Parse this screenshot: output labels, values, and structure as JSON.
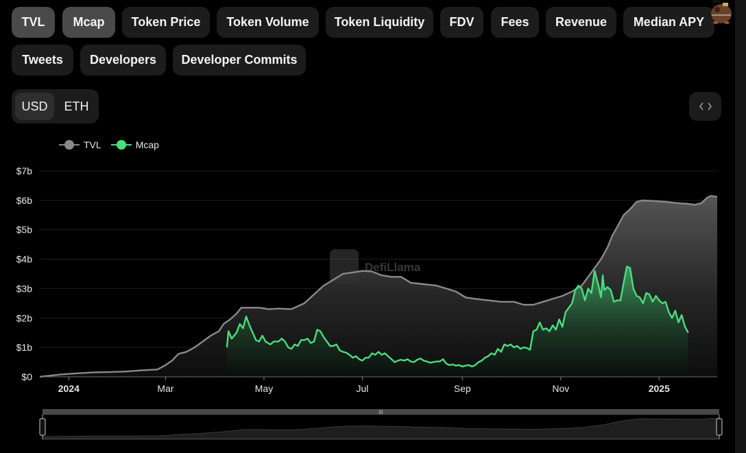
{
  "tabs": [
    {
      "label": "TVL",
      "active": true
    },
    {
      "label": "Mcap",
      "active": true
    },
    {
      "label": "Token Price",
      "active": false
    },
    {
      "label": "Token Volume",
      "active": false
    },
    {
      "label": "Token Liquidity",
      "active": false
    },
    {
      "label": "FDV",
      "active": false
    },
    {
      "label": "Fees",
      "active": false
    },
    {
      "label": "Revenue",
      "active": false
    },
    {
      "label": "Median APY",
      "active": false
    },
    {
      "label": "Tweets",
      "active": false
    },
    {
      "label": "Developers",
      "active": false
    },
    {
      "label": "Developer Commits",
      "active": false
    }
  ],
  "denomination": {
    "options": [
      "USD",
      "ETH"
    ],
    "selected": "USD"
  },
  "embed_button": {
    "icon": "code-brackets-icon",
    "glyph": "< >"
  },
  "mascot": {
    "icon": "llama-mascot-icon"
  },
  "watermark": {
    "text": "DefiLlama",
    "icon": "defillama-logo-icon"
  },
  "colors": {
    "tvl": "#8a8a8a",
    "mcap": "#4ade80",
    "tab_active_bg": "#4a4a4a",
    "tab_bg": "#1c1c1c",
    "background": "#000000"
  },
  "chart_data": {
    "type": "area",
    "title": "",
    "xlabel": "",
    "ylabel": "",
    "x_unit": "days since 2024-01-01",
    "xlim": [
      -18,
      402
    ],
    "ylim": [
      0,
      7
    ],
    "y_unit": "USD billions",
    "y_ticks": [
      {
        "value": 0,
        "label": "$0"
      },
      {
        "value": 1,
        "label": "$1b"
      },
      {
        "value": 2,
        "label": "$2b"
      },
      {
        "value": 3,
        "label": "$3b"
      },
      {
        "value": 4,
        "label": "$4b"
      },
      {
        "value": 5,
        "label": "$5b"
      },
      {
        "value": 6,
        "label": "$6b"
      },
      {
        "value": 7,
        "label": "$7b"
      }
    ],
    "x_ticks": [
      {
        "value": 0,
        "label": "2024",
        "bold": true
      },
      {
        "value": 60,
        "label": "Mar",
        "bold": false
      },
      {
        "value": 121,
        "label": "May",
        "bold": false
      },
      {
        "value": 182,
        "label": "Jul",
        "bold": false
      },
      {
        "value": 244,
        "label": "Sep",
        "bold": false
      },
      {
        "value": 305,
        "label": "Nov",
        "bold": false
      },
      {
        "value": 366,
        "label": "2025",
        "bold": true
      }
    ],
    "grid": true,
    "legend_position": "top-left",
    "series": [
      {
        "name": "TVL",
        "color": "#8a8a8a",
        "points": [
          [
            -18,
            0.0
          ],
          [
            -5,
            0.08
          ],
          [
            5,
            0.12
          ],
          [
            15,
            0.15
          ],
          [
            25,
            0.16
          ],
          [
            35,
            0.18
          ],
          [
            45,
            0.22
          ],
          [
            55,
            0.25
          ],
          [
            60,
            0.4
          ],
          [
            64,
            0.55
          ],
          [
            68,
            0.78
          ],
          [
            73,
            0.85
          ],
          [
            78,
            1.0
          ],
          [
            83,
            1.2
          ],
          [
            88,
            1.4
          ],
          [
            93,
            1.55
          ],
          [
            96,
            1.8
          ],
          [
            100,
            1.95
          ],
          [
            104,
            2.15
          ],
          [
            107,
            2.35
          ],
          [
            112,
            2.35
          ],
          [
            118,
            2.35
          ],
          [
            124,
            2.3
          ],
          [
            130,
            2.32
          ],
          [
            138,
            2.3
          ],
          [
            146,
            2.5
          ],
          [
            152,
            2.8
          ],
          [
            158,
            3.1
          ],
          [
            164,
            3.3
          ],
          [
            170,
            3.5
          ],
          [
            176,
            3.55
          ],
          [
            182,
            3.6
          ],
          [
            188,
            3.58
          ],
          [
            194,
            3.45
          ],
          [
            200,
            3.4
          ],
          [
            206,
            3.4
          ],
          [
            212,
            3.2
          ],
          [
            220,
            3.15
          ],
          [
            228,
            3.1
          ],
          [
            234,
            3.0
          ],
          [
            240,
            2.9
          ],
          [
            246,
            2.7
          ],
          [
            252,
            2.65
          ],
          [
            260,
            2.6
          ],
          [
            268,
            2.55
          ],
          [
            276,
            2.55
          ],
          [
            282,
            2.45
          ],
          [
            288,
            2.45
          ],
          [
            294,
            2.55
          ],
          [
            300,
            2.65
          ],
          [
            306,
            2.75
          ],
          [
            312,
            2.9
          ],
          [
            318,
            3.1
          ],
          [
            322,
            3.4
          ],
          [
            326,
            3.7
          ],
          [
            330,
            4.0
          ],
          [
            334,
            4.4
          ],
          [
            337,
            4.8
          ],
          [
            340,
            5.1
          ],
          [
            344,
            5.5
          ],
          [
            348,
            5.7
          ],
          [
            352,
            5.95
          ],
          [
            356,
            6.0
          ],
          [
            362,
            5.98
          ],
          [
            370,
            5.95
          ],
          [
            378,
            5.9
          ],
          [
            384,
            5.88
          ],
          [
            388,
            5.85
          ],
          [
            392,
            5.9
          ],
          [
            396,
            6.1
          ],
          [
            398,
            6.15
          ],
          [
            402,
            6.12
          ]
        ]
      },
      {
        "name": "Mcap",
        "color": "#4ade80",
        "points": [
          [
            98,
            1.0
          ],
          [
            99,
            1.55
          ],
          [
            101,
            1.3
          ],
          [
            104,
            1.5
          ],
          [
            106,
            1.8
          ],
          [
            108,
            1.65
          ],
          [
            110,
            2.05
          ],
          [
            112,
            1.75
          ],
          [
            114,
            1.5
          ],
          [
            116,
            1.25
          ],
          [
            118,
            1.2
          ],
          [
            120,
            1.4
          ],
          [
            122,
            1.2
          ],
          [
            125,
            1.1
          ],
          [
            127,
            1.2
          ],
          [
            130,
            1.2
          ],
          [
            132,
            1.3
          ],
          [
            134,
            1.2
          ],
          [
            136,
            1.0
          ],
          [
            138,
            0.95
          ],
          [
            140,
            1.1
          ],
          [
            142,
            1.05
          ],
          [
            144,
            1.25
          ],
          [
            146,
            1.25
          ],
          [
            148,
            1.3
          ],
          [
            150,
            1.15
          ],
          [
            152,
            1.2
          ],
          [
            154,
            1.6
          ],
          [
            156,
            1.55
          ],
          [
            158,
            1.35
          ],
          [
            160,
            1.2
          ],
          [
            162,
            1.05
          ],
          [
            164,
            1.05
          ],
          [
            166,
            1.1
          ],
          [
            168,
            0.9
          ],
          [
            170,
            0.85
          ],
          [
            172,
            0.82
          ],
          [
            174,
            0.75
          ],
          [
            176,
            0.65
          ],
          [
            178,
            0.7
          ],
          [
            180,
            0.6
          ],
          [
            182,
            0.55
          ],
          [
            184,
            0.65
          ],
          [
            186,
            0.65
          ],
          [
            188,
            0.8
          ],
          [
            190,
            0.75
          ],
          [
            192,
            0.85
          ],
          [
            194,
            0.75
          ],
          [
            196,
            0.8
          ],
          [
            198,
            0.7
          ],
          [
            200,
            0.6
          ],
          [
            202,
            0.5
          ],
          [
            204,
            0.55
          ],
          [
            206,
            0.58
          ],
          [
            208,
            0.55
          ],
          [
            210,
            0.6
          ],
          [
            212,
            0.52
          ],
          [
            214,
            0.5
          ],
          [
            216,
            0.58
          ],
          [
            218,
            0.62
          ],
          [
            220,
            0.55
          ],
          [
            222,
            0.52
          ],
          [
            224,
            0.48
          ],
          [
            226,
            0.5
          ],
          [
            228,
            0.52
          ],
          [
            230,
            0.52
          ],
          [
            232,
            0.6
          ],
          [
            234,
            0.45
          ],
          [
            236,
            0.4
          ],
          [
            238,
            0.42
          ],
          [
            240,
            0.38
          ],
          [
            242,
            0.4
          ],
          [
            244,
            0.35
          ],
          [
            246,
            0.38
          ],
          [
            248,
            0.4
          ],
          [
            250,
            0.35
          ],
          [
            252,
            0.4
          ],
          [
            254,
            0.5
          ],
          [
            256,
            0.55
          ],
          [
            258,
            0.65
          ],
          [
            260,
            0.7
          ],
          [
            262,
            0.8
          ],
          [
            264,
            0.75
          ],
          [
            266,
            0.95
          ],
          [
            268,
            0.85
          ],
          [
            270,
            1.1
          ],
          [
            272,
            1.05
          ],
          [
            274,
            1.1
          ],
          [
            276,
            1.0
          ],
          [
            278,
            1.05
          ],
          [
            280,
            0.95
          ],
          [
            282,
            1.0
          ],
          [
            284,
            0.98
          ],
          [
            286,
            0.92
          ],
          [
            288,
            1.55
          ],
          [
            290,
            1.6
          ],
          [
            292,
            1.85
          ],
          [
            294,
            1.6
          ],
          [
            296,
            1.65
          ],
          [
            298,
            1.55
          ],
          [
            300,
            1.75
          ],
          [
            302,
            1.6
          ],
          [
            304,
            1.95
          ],
          [
            306,
            1.7
          ],
          [
            308,
            2.2
          ],
          [
            310,
            2.35
          ],
          [
            312,
            2.5
          ],
          [
            314,
            2.95
          ],
          [
            316,
            3.1
          ],
          [
            318,
            3.0
          ],
          [
            320,
            2.6
          ],
          [
            322,
            3.0
          ],
          [
            324,
            2.85
          ],
          [
            326,
            3.6
          ],
          [
            328,
            3.2
          ],
          [
            330,
            2.7
          ],
          [
            331,
            3.45
          ],
          [
            332,
            2.95
          ],
          [
            334,
            3.05
          ],
          [
            336,
            2.95
          ],
          [
            338,
            2.55
          ],
          [
            340,
            2.6
          ],
          [
            342,
            2.6
          ],
          [
            344,
            3.2
          ],
          [
            346,
            3.75
          ],
          [
            348,
            3.7
          ],
          [
            350,
            3.0
          ],
          [
            352,
            2.75
          ],
          [
            354,
            2.7
          ],
          [
            356,
            2.5
          ],
          [
            358,
            2.85
          ],
          [
            360,
            2.8
          ],
          [
            362,
            2.55
          ],
          [
            364,
            2.75
          ],
          [
            366,
            2.6
          ],
          [
            368,
            2.5
          ],
          [
            370,
            2.55
          ],
          [
            372,
            2.2
          ],
          [
            374,
            2.0
          ],
          [
            376,
            2.25
          ],
          [
            378,
            1.85
          ],
          [
            380,
            2.1
          ],
          [
            382,
            1.7
          ],
          [
            384,
            1.5
          ]
        ]
      }
    ]
  },
  "brush": {
    "range_start_fraction": 0.0,
    "range_end_fraction": 1.0,
    "handle_glyph": "|||"
  }
}
